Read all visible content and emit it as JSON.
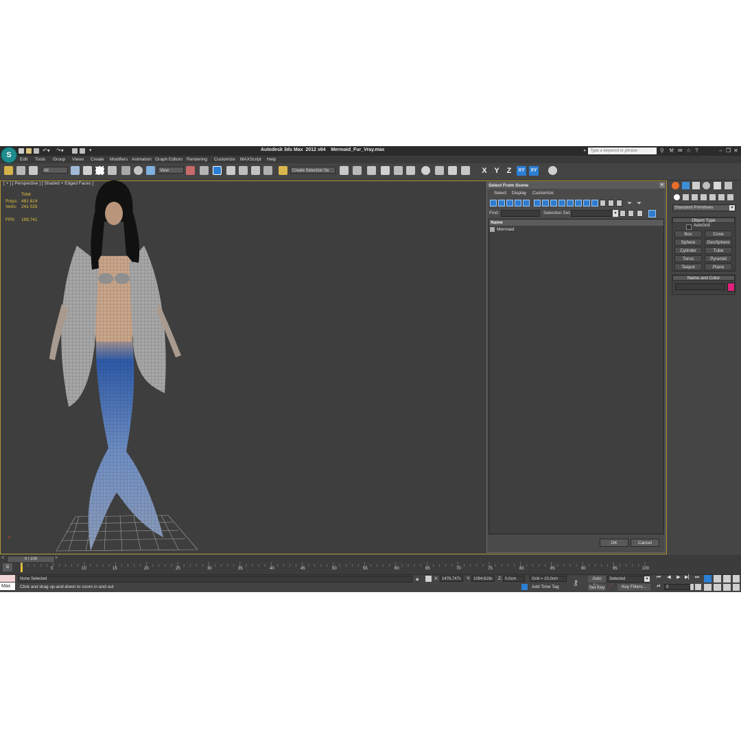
{
  "window": {
    "title": "Autodesk 3ds Max  2012 x64    Mermaid_Fur_Vray.max",
    "search_placeholder": "Type a keyword or phrase"
  },
  "menu": [
    "Edit",
    "Tools",
    "Group",
    "Views",
    "Create",
    "Modifiers",
    "Animation",
    "Graph Editors",
    "Rendering",
    "Customize",
    "MAXScript",
    "Help"
  ],
  "toolbar": {
    "selection_filter": "All",
    "reference_coord": "View",
    "named_selection": "Create Selection Se",
    "axes": [
      "X",
      "Y",
      "Z",
      "XY",
      "XY"
    ]
  },
  "viewport": {
    "label": "[ + ] [ Perspective ] [ Shaded + Edged Faces ]",
    "stats": {
      "total_label": "Total",
      "polys_label": "Polys:",
      "polys_value": "481 814",
      "verts_label": "Verts:",
      "verts_value": "241 025",
      "fps_label": "FPS:",
      "fps_value": "199,741"
    }
  },
  "dialog": {
    "title": "Select From Scene",
    "menu": [
      "Select",
      "Display",
      "Customize"
    ],
    "find_label": "Find:",
    "selection_set_label": "Selection Set:",
    "column_name": "Name",
    "rows": [
      "Mermaid"
    ],
    "ok": "OK",
    "cancel": "Cancel"
  },
  "command_panel": {
    "category": "Standard Primitives",
    "object_type": "Object Type",
    "autogrid": "AutoGrid",
    "primitives": [
      "Box",
      "Cone",
      "Sphere",
      "GeoSphere",
      "Cylinder",
      "Tube",
      "Torus",
      "Pyramid",
      "Teapot",
      "Plane"
    ],
    "name_and_color": "Name and Color",
    "object_color": "#e0217a"
  },
  "timeline": {
    "frame_display": "0 / 100",
    "ticks": [
      "5",
      "10",
      "15",
      "20",
      "25",
      "30",
      "35",
      "40",
      "45",
      "50",
      "55",
      "60",
      "65",
      "70",
      "75",
      "80",
      "85",
      "90",
      "95",
      "100"
    ]
  },
  "status": {
    "maxscript_label": "Max",
    "selection": "None Selected",
    "prompt": "Click and drag up-and-down to zoom in and out",
    "x_label": "X:",
    "x_value": "1478,747c",
    "y_label": "Y:",
    "y_value": "1084,619c",
    "z_label": "Z:",
    "z_value": "0,0cm",
    "grid": "Grid = 10,0cm",
    "add_time_tag": "Add Time Tag",
    "auto_key": "Auto Key",
    "set_key": "Set Key",
    "key_mode": "Selected",
    "key_filters": "Key Filters...",
    "current_frame": "0"
  }
}
